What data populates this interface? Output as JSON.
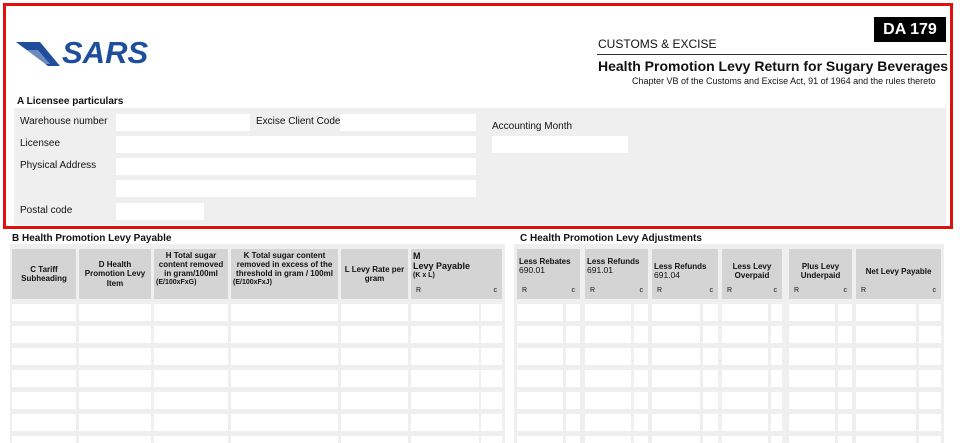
{
  "header": {
    "logo_text": "SARS",
    "badge": "DA 179",
    "department": "CUSTOMS & EXCISE",
    "title": "Health Promotion Levy Return for Sugary Beverages",
    "subtitle": "Chapter VB of the Customs and Excise Act, 91 of 1964 and the rules thereto",
    "colors": {
      "logo_blue": "#1f4e9c",
      "highlight_frame": "#e01010"
    }
  },
  "section_a": {
    "title": "A Licensee particulars",
    "warehouse_label": "Warehouse number",
    "excise_client_label": "Excise Client Code",
    "accounting_month_label": "Accounting Month",
    "licensee_label": "Licensee",
    "physical_address_label": "Physical Address",
    "postal_code_label": "Postal code"
  },
  "section_b": {
    "title": "B Health Promotion Levy Payable",
    "columns": {
      "c": "C Tariff Subheading",
      "d": "D Health Promotion Levy Item",
      "h": "H Total sugar content removed in gram/100ml",
      "h_formula": "(E/100xFxG)",
      "k": "K Total sugar  content removed in excess of the threshold in gram / 100ml",
      "k_formula": "(E/100xFxJ)",
      "l": "L Levy Rate per gram",
      "m_code": "M",
      "m": "Levy Payable",
      "m_formula": "(K x L)",
      "rand": "R",
      "cents": "c"
    }
  },
  "section_c": {
    "title": "C Health Promotion Levy Adjustments",
    "columns": {
      "rebates": "Less Rebates",
      "rebates_code": "690.01",
      "refunds": "Less Refunds",
      "refunds_code": "691.01",
      "refunds2": "Less Refunds",
      "refunds2_code": "691.04",
      "overpaid": "Less Levy Overpaid",
      "underpaid": "Plus Levy Underpaid",
      "net": "Net Levy Payable",
      "rand": "R",
      "cents": "c"
    }
  }
}
